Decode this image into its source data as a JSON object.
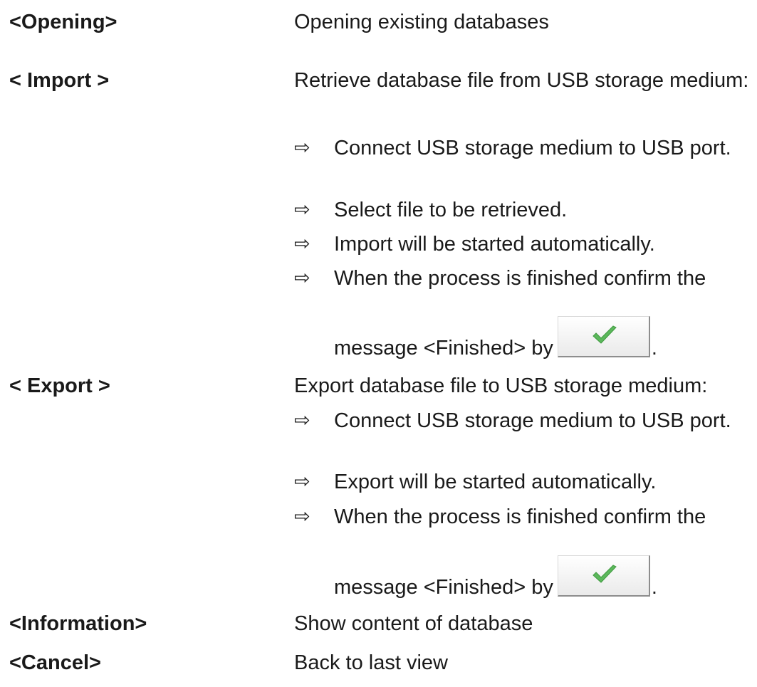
{
  "rows": {
    "opening": {
      "term": "<Opening>",
      "desc": "Opening existing databases"
    },
    "import": {
      "term": "< Import >",
      "desc": "Retrieve database file from USB storage medium:",
      "steps": [
        "Connect USB storage medium to USB port.",
        "Select file to be retrieved.",
        "Import will be started automatically.",
        "When the process is finished confirm the"
      ],
      "last_line": "message <Finished> by",
      "last_end": "."
    },
    "export": {
      "term": "< Export >",
      "desc": "Export database file to USB storage medium:",
      "steps": [
        "Connect USB storage medium to USB port.",
        "Export will be started automatically.",
        "When the process is finished confirm the"
      ],
      "last_line": "message <Finished> by",
      "last_end": "."
    },
    "information": {
      "term": "<Information>",
      "desc": "Show content of database"
    },
    "cancel": {
      "term": "<Cancel>",
      "desc": "Back to last view"
    }
  },
  "bullet_icon": "right-arrow-outline",
  "confirm_icon": "green-check",
  "colors": {
    "text": "#1a1a1a",
    "check_green": "#5cb85c"
  }
}
